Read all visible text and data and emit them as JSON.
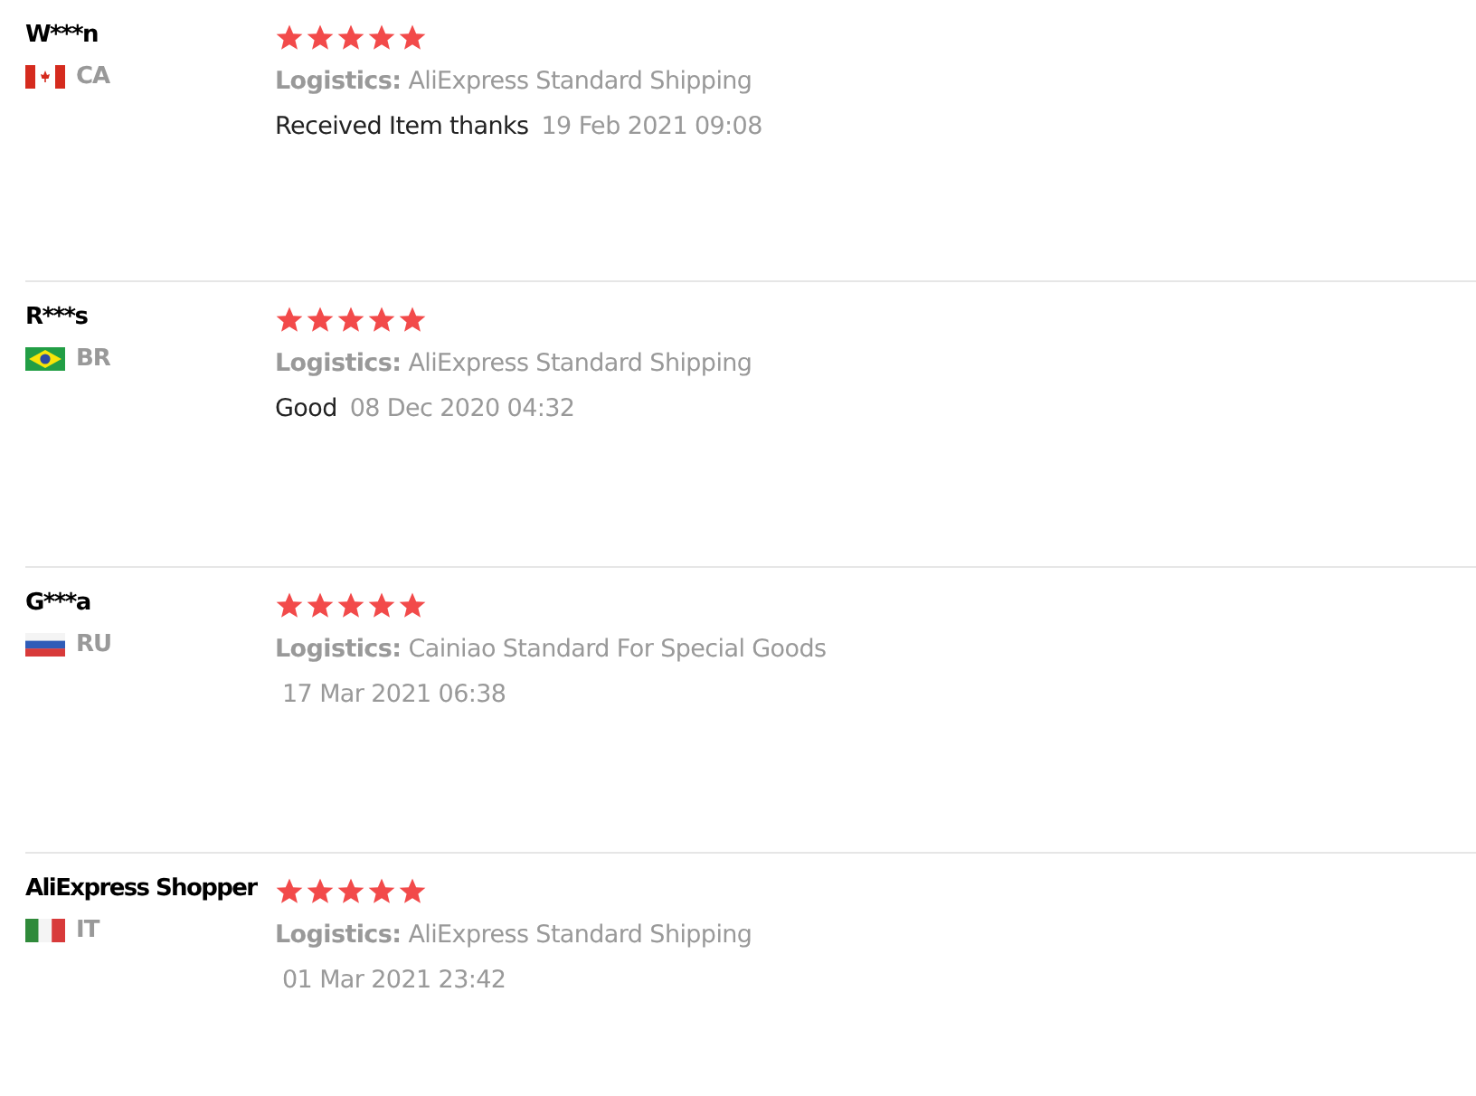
{
  "reviews": [
    {
      "name": "W***n",
      "flag": {
        "kind": "canada"
      },
      "country": "CA",
      "stars": 5,
      "logistics": "**Logistics:** AliExpress Standard Shipping",
      "comment": "Received Item thanks",
      "date": "19 Feb 2021 09:08"
    },
    {
      "name": "R***s",
      "flag": {
        "kind": "brazil"
      },
      "country": "BR",
      "stars": 5,
      "logistics": "**Logistics:** AliExpress Standard Shipping",
      "comment": "Good",
      "date": "08 Dec 2020 04:32"
    },
    {
      "name": "G***a",
      "flag": {
        "kind": "russia"
      },
      "country": "RU",
      "stars": 5,
      "logistics": "**Logistics:** Cainiao Standard For Special Goods",
      "date": "17 Mar 2021 06:38"
    },
    {
      "name": "AliExpress Shopper",
      "flag": {
        "kind": "italy"
      },
      "country": "IT",
      "stars": 5,
      "logistics": "**Logistics:** AliExpress Standard Shipping",
      "date": "01 Mar 2021 23:42"
    }
  ]
}
